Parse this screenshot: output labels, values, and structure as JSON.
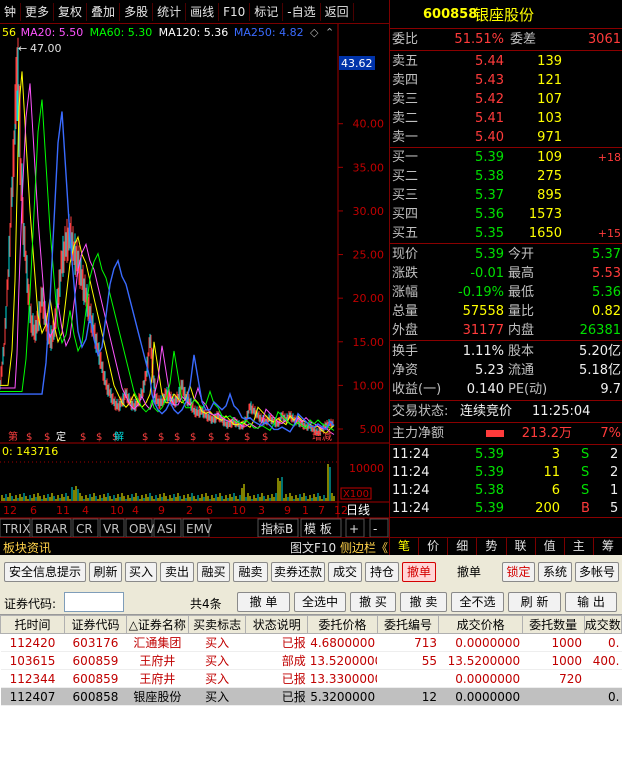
{
  "toolbar": {
    "items": [
      "钟",
      "更多",
      "复权",
      "叠加",
      "多股",
      "统计",
      "画线",
      "F10",
      "标记",
      "-自选",
      "返回"
    ]
  },
  "chart": {
    "ma_labels": [
      {
        "text": "56",
        "color": "#ffff00"
      },
      {
        "text": "MA20: 5.50",
        "color": "#ff55ff"
      },
      {
        "text": "MA60: 5.30",
        "color": "#00ff00"
      },
      {
        "text": "MA120: 5.36",
        "color": "#ffffff"
      },
      {
        "text": "MA250: 4.82",
        "color": "#3a6bff"
      }
    ],
    "max_label": "47.00",
    "current_price_tag": "43.62",
    "y_ticks": [
      "40.00",
      "35.00",
      "30.00",
      "25.00",
      "20.00",
      "15.00",
      "10.00",
      "5.00"
    ],
    "volume_label": "0: 143716",
    "volume_ticks": [
      "10000",
      "X100"
    ],
    "markers": [
      "第",
      "$",
      "$",
      "定",
      "$",
      "$",
      "$",
      "解",
      "$",
      "$",
      "$",
      "$",
      "$",
      "$",
      "$",
      "$",
      "增减"
    ],
    "x_ticks": [
      "12",
      "6",
      "11",
      "4",
      "10",
      "4",
      "9",
      "2",
      "6",
      "10",
      "3",
      "9",
      "1",
      "7",
      "12",
      "6"
    ],
    "tabs": [
      "TRIX",
      "BRAR",
      "CR",
      "VR",
      "OBV",
      "ASI",
      "EMV",
      "指标B",
      "模 板",
      "+",
      "-"
    ],
    "period": "日线",
    "period_arrows": [
      "▸"
    ]
  },
  "quote": {
    "code": "600858",
    "name": "银座股份",
    "weibi_label": "委比",
    "weibi_value": "51.51%",
    "weicha_label": "委差",
    "weicha_value": "3061",
    "sells": [
      {
        "label": "卖五",
        "price": "5.44",
        "vol": "139"
      },
      {
        "label": "卖四",
        "price": "5.43",
        "vol": "121"
      },
      {
        "label": "卖三",
        "price": "5.42",
        "vol": "107"
      },
      {
        "label": "卖二",
        "price": "5.41",
        "vol": "103"
      },
      {
        "label": "卖一",
        "price": "5.40",
        "vol": "971"
      }
    ],
    "buys": [
      {
        "label": "买一",
        "price": "5.39",
        "vol": "109",
        "chg": "+18"
      },
      {
        "label": "买二",
        "price": "5.38",
        "vol": "275",
        "chg": ""
      },
      {
        "label": "买三",
        "price": "5.37",
        "vol": "895",
        "chg": ""
      },
      {
        "label": "买四",
        "price": "5.36",
        "vol": "1573",
        "chg": ""
      },
      {
        "label": "买五",
        "price": "5.35",
        "vol": "1650",
        "chg": "+15"
      }
    ],
    "stats1": [
      {
        "l1": "现价",
        "v1": "5.39",
        "c1": "grn",
        "l2": "今开",
        "v2": "5.37",
        "c2": "grn"
      },
      {
        "l1": "涨跌",
        "v1": "-0.01",
        "c1": "grn",
        "l2": "最高",
        "v2": "5.53",
        "c2": "red"
      },
      {
        "l1": "涨幅",
        "v1": "-0.19%",
        "c1": "grn",
        "l2": "最低",
        "v2": "5.36",
        "c2": "grn"
      },
      {
        "l1": "总量",
        "v1": "57558",
        "c1": "yel",
        "l2": "量比",
        "v2": "0.82",
        "c2": "yel"
      },
      {
        "l1": "外盘",
        "v1": "31177",
        "c1": "red",
        "l2": "内盘",
        "v2": "26381",
        "c2": "grn"
      }
    ],
    "stats2": [
      {
        "l1": "换手",
        "v1": "1.11%",
        "l2": "股本",
        "v2": "5.20亿"
      },
      {
        "l1": "净资",
        "v1": "5.23",
        "l2": "流通",
        "v2": "5.18亿"
      },
      {
        "l1": "收益(一)",
        "v1": "0.140",
        "l2": "PE(动)",
        "v2": "9.7"
      }
    ],
    "trade_status_label": "交易状态:",
    "trade_status": "连续竞价",
    "trade_time": "11:25:04",
    "net_label": "主力净额",
    "net_value": "213.2万",
    "net_pct": "7%",
    "ticks": [
      {
        "t": "11:24",
        "p": "5.39",
        "v": "3",
        "s": "S",
        "n": "2"
      },
      {
        "t": "11:24",
        "p": "5.39",
        "v": "11",
        "s": "S",
        "n": "2"
      },
      {
        "t": "11:24",
        "p": "5.38",
        "v": "6",
        "s": "S",
        "n": "1"
      },
      {
        "t": "11:24",
        "p": "5.39",
        "v": "200",
        "s": "B",
        "n": "5"
      }
    ],
    "bottom_tabs": [
      "笔",
      "价",
      "细",
      "势",
      "联",
      "值",
      "主",
      "筹"
    ]
  },
  "midbar": {
    "left": "板块资讯",
    "right": "图文F10",
    "right2": "侧边栏《"
  },
  "trade": {
    "buttons": [
      "安全信息提示",
      "刷新",
      "买入",
      "卖出",
      "融买",
      "融卖",
      "卖券还款",
      "成交",
      "持仓",
      "撤单",
      "撤单",
      "锁定",
      "系统",
      "多帐号"
    ],
    "code_label": "证券代码:",
    "count": "共4条",
    "action_buttons": [
      "撤 单",
      "全选中",
      "撤 买",
      "撤 卖",
      "全不选",
      "刷 新",
      "输 出"
    ],
    "columns": [
      "托时间",
      "证券代码",
      "△证券名称",
      "买卖标志",
      "状态说明",
      "委托价格",
      "委托编号",
      "成交价格",
      "委托数量",
      "成交数"
    ],
    "rows": [
      {
        "time": "112420",
        "code": "603176",
        "name": "汇通集团",
        "side": "买入",
        "status": "已报",
        "price": "4.6800000",
        "no": "713",
        "deal": "0.0000000",
        "qty": "1000",
        "dqty": "0."
      },
      {
        "time": "103615",
        "code": "600859",
        "name": "王府井",
        "side": "买入",
        "status": "部成",
        "price": "13.5200000",
        "no": "55",
        "deal": "13.5200000",
        "qty": "1000",
        "dqty": "400."
      },
      {
        "time": "112344",
        "code": "600859",
        "name": "王府井",
        "side": "买入",
        "status": "已报",
        "price": "13.3300000",
        "no": "",
        "deal": "0.0000000",
        "qty": "720",
        "dqty": ""
      },
      {
        "time": "112407",
        "code": "600858",
        "name": "银座股份",
        "side": "买入",
        "status": "已报",
        "price": "5.3200000",
        "no": "12",
        "deal": "0.0000000",
        "qty": "",
        "dqty": "0."
      }
    ]
  }
}
